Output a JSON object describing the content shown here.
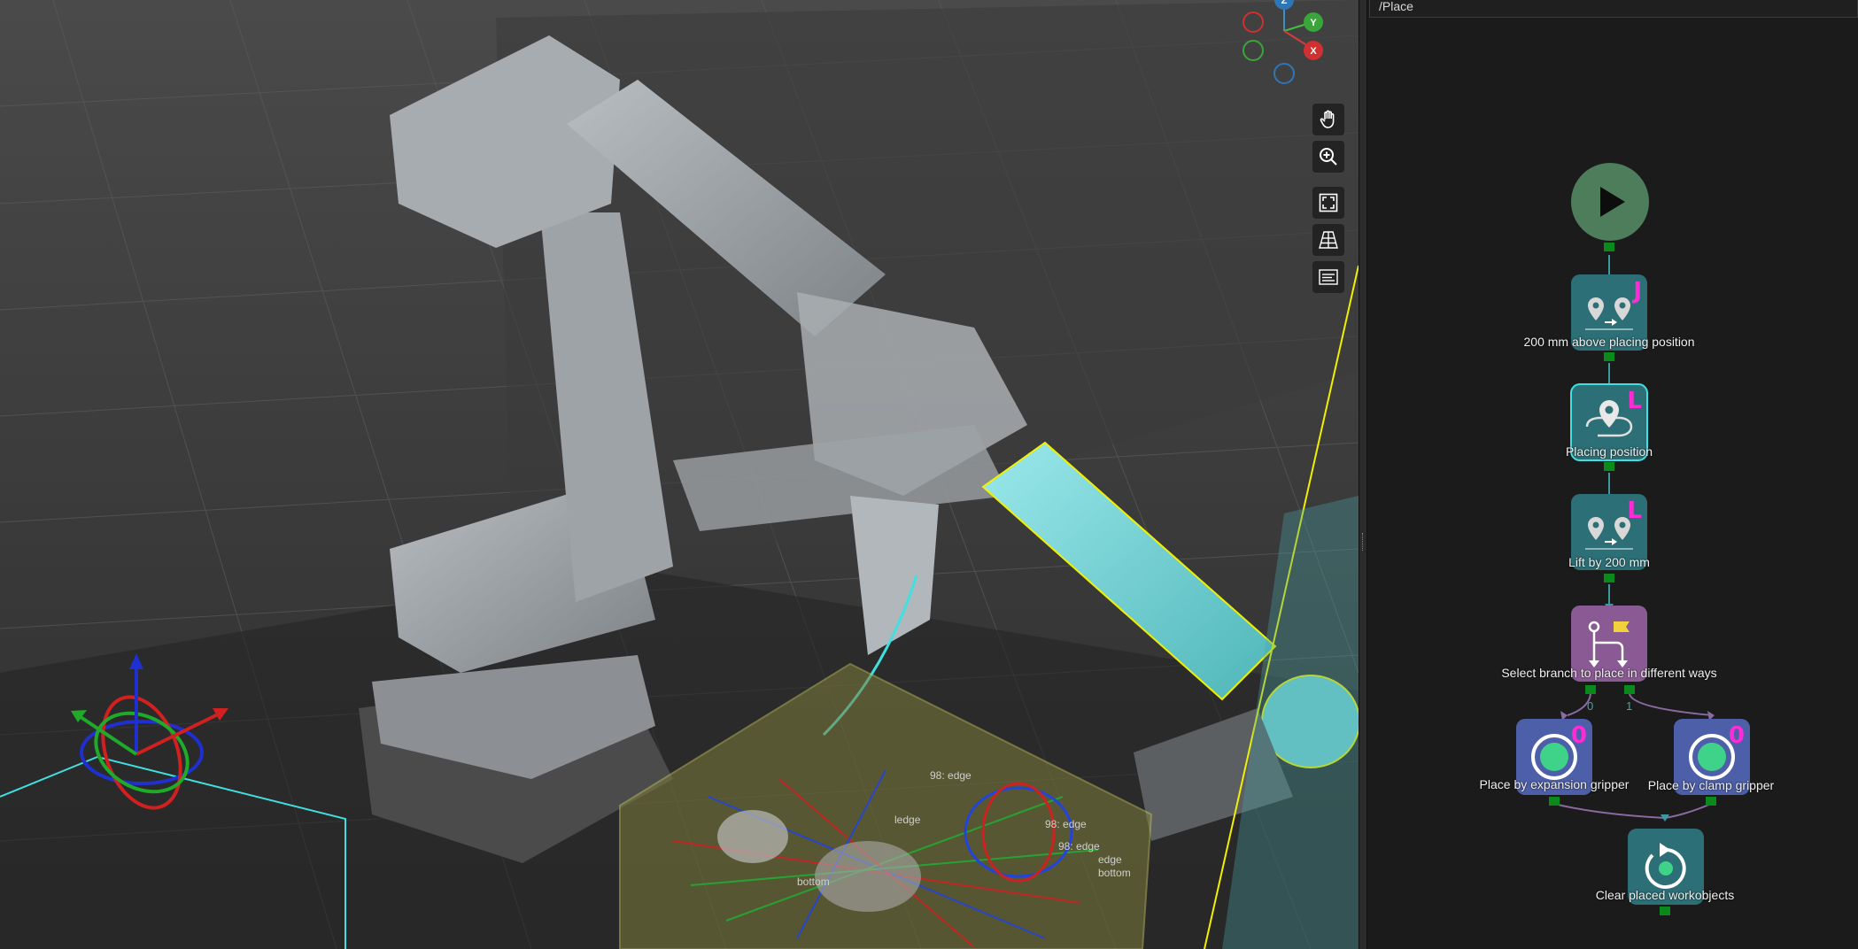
{
  "panel": {
    "path": "/Place"
  },
  "gizmo": {
    "z_label": "Z",
    "y_label": "Y",
    "x_label": "X"
  },
  "toolbar": {
    "tools": [
      "pan-icon",
      "zoom-in-icon",
      "fit-view-icon",
      "grid-view-icon",
      "label-list-icon"
    ]
  },
  "flow": {
    "start": {
      "icon": "play-icon"
    },
    "nodes": [
      {
        "id": "n1",
        "label": "200 mm above placing position",
        "badge": "J",
        "icon": "relative-move-icon"
      },
      {
        "id": "n2",
        "label": "Placing position",
        "badge": "L",
        "icon": "fixed-waypoint-icon",
        "selected": true
      },
      {
        "id": "n3",
        "label": "Lift by 200 mm",
        "badge": "L",
        "icon": "relative-move-icon"
      },
      {
        "id": "n4",
        "label": "Select branch to place in different ways",
        "icon": "branch-icon"
      },
      {
        "id": "n5",
        "label": "Place by expansion gripper",
        "badge": "0",
        "icon": "set-do-icon"
      },
      {
        "id": "n6",
        "label": "Place by clamp gripper",
        "badge": "0",
        "icon": "set-do-icon"
      },
      {
        "id": "n7",
        "label": "Clear placed workobjects",
        "icon": "reset-icon"
      }
    ],
    "branch_ports": [
      "0",
      "1"
    ]
  },
  "scene": {
    "pose_labels": [
      "98: edge",
      "98: edge",
      "ledge",
      "bottom",
      "98: edge",
      "edge",
      "bottom"
    ],
    "colors": {
      "selected_link": "#5ecfd2",
      "bin": "#8a8a3a",
      "highlight": "#f0f000",
      "grid": "#555555"
    }
  }
}
